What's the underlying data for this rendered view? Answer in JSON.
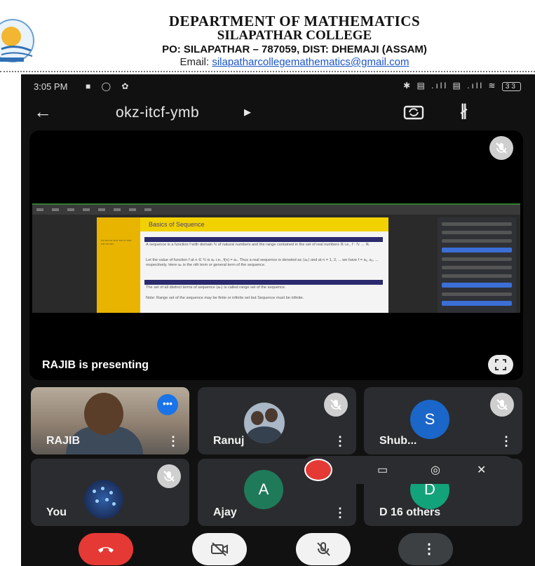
{
  "letterhead": {
    "line1": "DEPARTMENT OF MATHEMATICS",
    "line2": "SILAPATHAR COLLEGE",
    "line3": "PO: SILAPATHAR – 787059, DIST: DHEMAJI (ASSAM)",
    "email_label": "Email: ",
    "email": "silapatharcollegemathematics@gmail.com"
  },
  "status_bar": {
    "time": "3:05 PM",
    "battery": "33"
  },
  "meet": {
    "code": "okz-itcf-ymb",
    "presenter_text": "RAJIB is presenting"
  },
  "shared_screen": {
    "slide_title": "Basics of Sequence",
    "block1_label": "Definition",
    "block1_text": "A sequence is a function f with domain ℕ of natural numbers and the range contained in the set of real numbers ℝ i.e., f : ℕ → ℝ.",
    "para1": "Let the value of function f at n ∈ ℕ is aₙ i.e., f(n) = aₙ. Thus a real sequence is denoted as ⟨aₙ⟩ and at n = 1, 2, ... we have f = a₁, a₂, ... respectively. Here aₙ is the nth term or general term of the sequence.",
    "block2_label": "Definition",
    "block2_text": "The set of all distinct terms of sequence ⟨aₙ⟩ is called range set of the sequence.",
    "note": "Note: Range set of the sequence may be finite or infinite set but Sequence must be infinite."
  },
  "participants": [
    {
      "name": "RAJIB",
      "avatar": "photo"
    },
    {
      "name": "Ranuj",
      "avatar": "photo"
    },
    {
      "name": "Shub...",
      "initial": "S",
      "color": "#1a66c9"
    },
    {
      "name": "You",
      "avatar": "photo"
    },
    {
      "name": "Ajay",
      "initial": "A",
      "color": "#1f7a5a"
    },
    {
      "name": "16 others",
      "initial": "D",
      "color": "#13a37a",
      "partial_name": "D"
    }
  ],
  "colors": {
    "end_call": "#e53935",
    "recording": "#e53935",
    "speaking": "#1a73e8"
  }
}
